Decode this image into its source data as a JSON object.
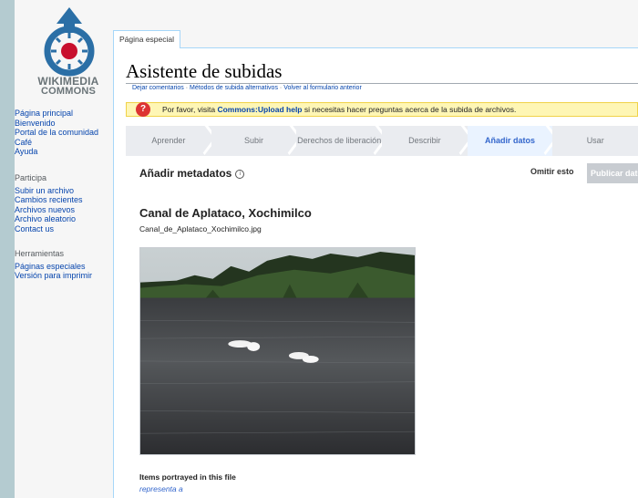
{
  "logo": {
    "line1": "WIKIMEDIA",
    "line2": "COMMONS"
  },
  "sidebar": {
    "main": [
      "Página principal",
      "Bienvenido",
      "Portal de la comunidad",
      "Café",
      "Ayuda"
    ],
    "participate_heading": "Participa",
    "participate": [
      "Subir un archivo",
      "Cambios recientes",
      "Archivos nuevos",
      "Archivo aleatorio",
      "Contact us"
    ],
    "tools_heading": "Herramientas",
    "tools": [
      "Páginas especiales",
      "Versión para imprimir"
    ]
  },
  "tab": {
    "label": "Página especial"
  },
  "page": {
    "title": "Asistente de subidas",
    "links": [
      "Dejar comentarios",
      "Métodos de subida alternativos",
      "Volver al formulario anterior"
    ],
    "link_sep": " · "
  },
  "notice": {
    "pre": "Por favor, visita ",
    "link": "Commons:Upload help",
    "post": " si necesitas hacer preguntas acerca de la subida de archivos."
  },
  "steps": [
    "Aprender",
    "Subir",
    "Derechos de liberación",
    "Describir",
    "Añadir datos",
    "Usar"
  ],
  "active_step": 4,
  "metadata": {
    "heading": "Añadir metadatos",
    "info_glyph": "i",
    "skip_label": "Omitir esto",
    "publish_label": "Publicar datos"
  },
  "file": {
    "title": "Canal de Aplataco, Xochimilco",
    "filename": "Canal_de_Aplataco_Xochimilco.jpg"
  },
  "items": {
    "label": "Items portrayed in this file",
    "sublabel": "representa a"
  },
  "colors": {
    "link": "#0645ad",
    "accent": "#36c",
    "notice_bg": "#fef6b5"
  }
}
